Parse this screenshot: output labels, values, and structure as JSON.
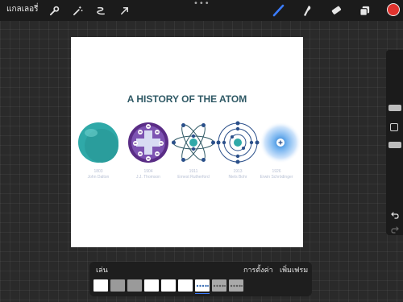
{
  "toolbar": {
    "gallery_label": "แกลเลอรี่",
    "tools_left": [
      "wrench-icon",
      "magic-wand-icon",
      "selection-icon",
      "transform-arrow-icon"
    ],
    "tools_right": [
      "brush-icon",
      "smudge-icon",
      "eraser-icon",
      "layers-icon"
    ],
    "more_label": "•••",
    "current_color": "#e0332e",
    "accent": "#3b7cff"
  },
  "canvas": {
    "title": "A HISTORY OF THE ATOM",
    "models": [
      {
        "year": "1803",
        "name": "John Dalton"
      },
      {
        "year": "1904",
        "name": "J.J. Thomson"
      },
      {
        "year": "1911",
        "name": "Ernest Rutherford"
      },
      {
        "year": "1913",
        "name": "Niels Bohr"
      },
      {
        "year": "1926",
        "name": "Erwin Schrödinger"
      }
    ]
  },
  "animation": {
    "play_label": "เล่น",
    "settings_label": "การตั้งค่า",
    "add_frame_label": "เพิ่มเฟรม",
    "frames": [
      {
        "kind": "blank"
      },
      {
        "kind": "gray"
      },
      {
        "kind": "gray"
      },
      {
        "kind": "blank"
      },
      {
        "kind": "blank"
      },
      {
        "kind": "blank"
      },
      {
        "kind": "atoms",
        "active": true
      },
      {
        "kind": "atoms-gray"
      },
      {
        "kind": "atoms-gray"
      }
    ]
  }
}
